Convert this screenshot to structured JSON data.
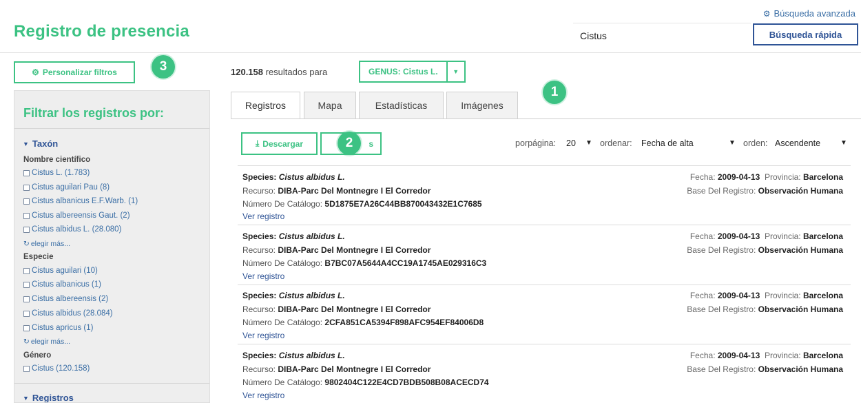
{
  "header": {
    "title": "Registro de presencia",
    "advanced_search": "Búsqueda avanzada",
    "search_value": "Cistus",
    "quick_search": "Búsqueda rápida"
  },
  "markers": [
    "1",
    "2",
    "3"
  ],
  "filters_button": "Personalizar filtros",
  "sidebar": {
    "title": "Filtrar los registros por:",
    "taxon_section": "Taxón",
    "sci_name_label": "Nombre científico",
    "sci_names": [
      "Cistus L. (1.783)",
      "Cistus aguilari Pau (8)",
      "Cistus albanicus E.F.Warb. (1)",
      "Cistus albereensis Gaut. (2)",
      "Cistus albidus L. (28.080)"
    ],
    "more_label": "elegir más...",
    "species_label": "Especie",
    "species": [
      "Cistus aguilari (10)",
      "Cistus albanicus (1)",
      "Cistus albereensis (2)",
      "Cistus albidus (28.084)",
      "Cistus apricus (1)"
    ],
    "genus_label": "Género",
    "genus": [
      "Cistus (120.158)"
    ],
    "records_section": "Registros"
  },
  "results": {
    "count": "120.158",
    "text": "resultados para",
    "genus_tag": "GENUS: Cistus L."
  },
  "tabs": [
    "Registros",
    "Mapa",
    "Estadísticas",
    "Imágenes"
  ],
  "toolbar": {
    "download": "Descargar",
    "alerts_partial": "s",
    "per_page_label": "porpágina:",
    "per_page_value": "20",
    "sort_label": "ordenar:",
    "sort_value": "Fecha de alta",
    "order_label": "orden:",
    "order_value": "Ascendente"
  },
  "record_labels": {
    "species": "Species:",
    "resource": "Recurso:",
    "catalog": "Número De Catálogo:",
    "view": "Ver registro",
    "date": "Fecha:",
    "province": "Provincia:",
    "basis": "Base Del Registro:"
  },
  "records": [
    {
      "species": "Cistus albidus L.",
      "resource": "DIBA-Parc Del Montnegre I El Corredor",
      "catalog": "5D1875E7A26C44BB870043432E1C7685",
      "date": "2009-04-13",
      "province": "Barcelona",
      "basis": "Observación Humana"
    },
    {
      "species": "Cistus albidus L.",
      "resource": "DIBA-Parc Del Montnegre I El Corredor",
      "catalog": "B7BC07A5644A4CC19A1745AE029316C3",
      "date": "2009-04-13",
      "province": "Barcelona",
      "basis": "Observación Humana"
    },
    {
      "species": "Cistus albidus L.",
      "resource": "DIBA-Parc Del Montnegre I El Corredor",
      "catalog": "2CFA851CA5394F898AFC954EF84006D8",
      "date": "2009-04-13",
      "province": "Barcelona",
      "basis": "Observación Humana"
    },
    {
      "species": "Cistus albidus L.",
      "resource": "DIBA-Parc Del Montnegre I El Corredor",
      "catalog": "9802404C122E4CD7BDB508B08ACECD74",
      "date": "2009-04-13",
      "province": "Barcelona",
      "basis": "Observación Humana"
    }
  ]
}
